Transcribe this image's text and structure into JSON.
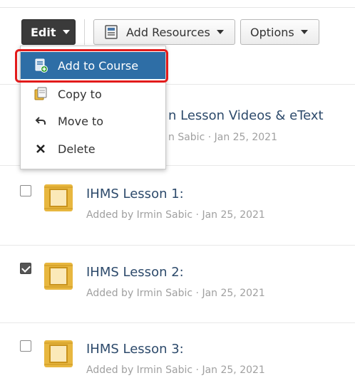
{
  "toolbar": {
    "edit_label": "Edit",
    "add_resources_label": "Add Resources",
    "options_label": "Options"
  },
  "edit_menu": {
    "items": [
      {
        "label": "Add to Course",
        "icon": "add-to-course-icon"
      },
      {
        "label": "Copy to",
        "icon": "copy-icon"
      },
      {
        "label": "Move to",
        "icon": "move-arrow-icon"
      },
      {
        "label": "Delete",
        "icon": "delete-x-icon"
      }
    ]
  },
  "list": {
    "rows": [
      {
        "title_visible": "n Lesson Videos & eText",
        "meta_visible": "n Sabic · Jan 25, 2021",
        "checked": false
      },
      {
        "title": "IHMS Lesson 1:",
        "meta": "Added by Irmin Sabic · Jan 25, 2021",
        "checked": false
      },
      {
        "title": "IHMS Lesson 2:",
        "meta": "Added by Irmin Sabic · Jan 25, 2021",
        "checked": true
      },
      {
        "title": "IHMS Lesson 3:",
        "meta": "Added by Irmin Sabic · Jan 25, 2021",
        "checked": false
      }
    ]
  },
  "colors": {
    "menu_active": "#2e6ea6",
    "highlight": "#e21b1b",
    "title_link": "#2d4a6b",
    "folder_icon": "#e8b73f"
  }
}
